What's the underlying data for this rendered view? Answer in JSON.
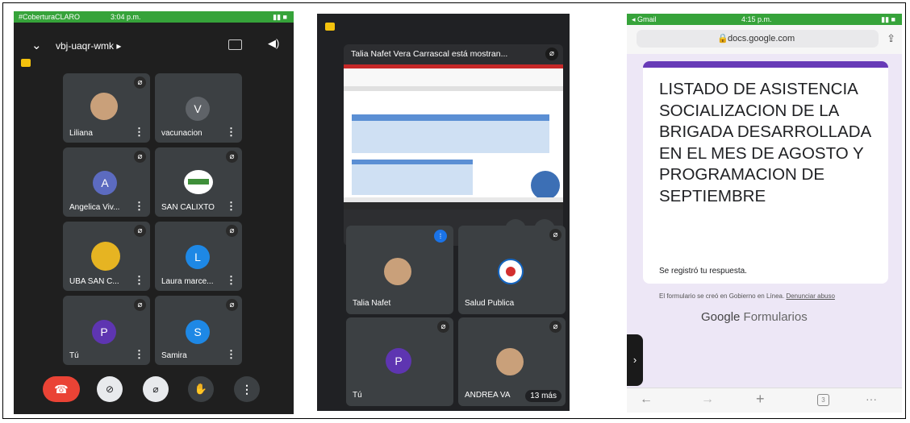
{
  "phone1": {
    "status": {
      "carrier": "#CoberturaCLARO",
      "time": "3:04 p.m."
    },
    "meeting_code": "vbj-uaqr-wmk ▸",
    "tiles": [
      {
        "name": "Liliana",
        "avatar": "",
        "avatar_color": "#c9a07a"
      },
      {
        "name": "vacunacion",
        "avatar": "V",
        "avatar_color": "#5f6368"
      },
      {
        "name": "Angelica Viv...",
        "avatar": "A",
        "avatar_color": "#5c6bc0"
      },
      {
        "name": "SAN CALIXTO",
        "avatar": "",
        "avatar_color": "#ffffff"
      },
      {
        "name": "UBA SAN C...",
        "avatar": "",
        "avatar_color": "#e6b422"
      },
      {
        "name": "Laura marce...",
        "avatar": "L",
        "avatar_color": "#1e88e5"
      },
      {
        "name": "Tú",
        "avatar": "P",
        "avatar_color": "#5e35b1"
      },
      {
        "name": "Samira",
        "avatar": "S",
        "avatar_color": "#1e88e5"
      }
    ]
  },
  "phone2": {
    "presenting_banner": "Talia Nafet Vera Carrascal está mostran...",
    "tiles": [
      {
        "name": "Talia Nafet"
      },
      {
        "name": "Salud Publica"
      },
      {
        "name": "Tú",
        "avatar": "P"
      },
      {
        "name": "ANDREA VA"
      }
    ],
    "more_count": "13 más"
  },
  "phone3": {
    "status": {
      "carrier": "◂ Gmail",
      "time": "4:15 p.m."
    },
    "url": "docs.google.com",
    "form_title": "LISTADO DE ASISTENCIA SOCIALIZACION DE LA BRIGADA DESARROLLADA EN EL MES DE AGOSTO Y PROGRAMACION DE SEPTIEMBRE",
    "response_text": "Se registró tu respuesta.",
    "footer_text": "El formulario se creó en Gobierno en Línea.",
    "report_link": "Denunciar abuso",
    "brand_google": "Google",
    "brand_product": "Formularios",
    "tab_count": "3"
  }
}
